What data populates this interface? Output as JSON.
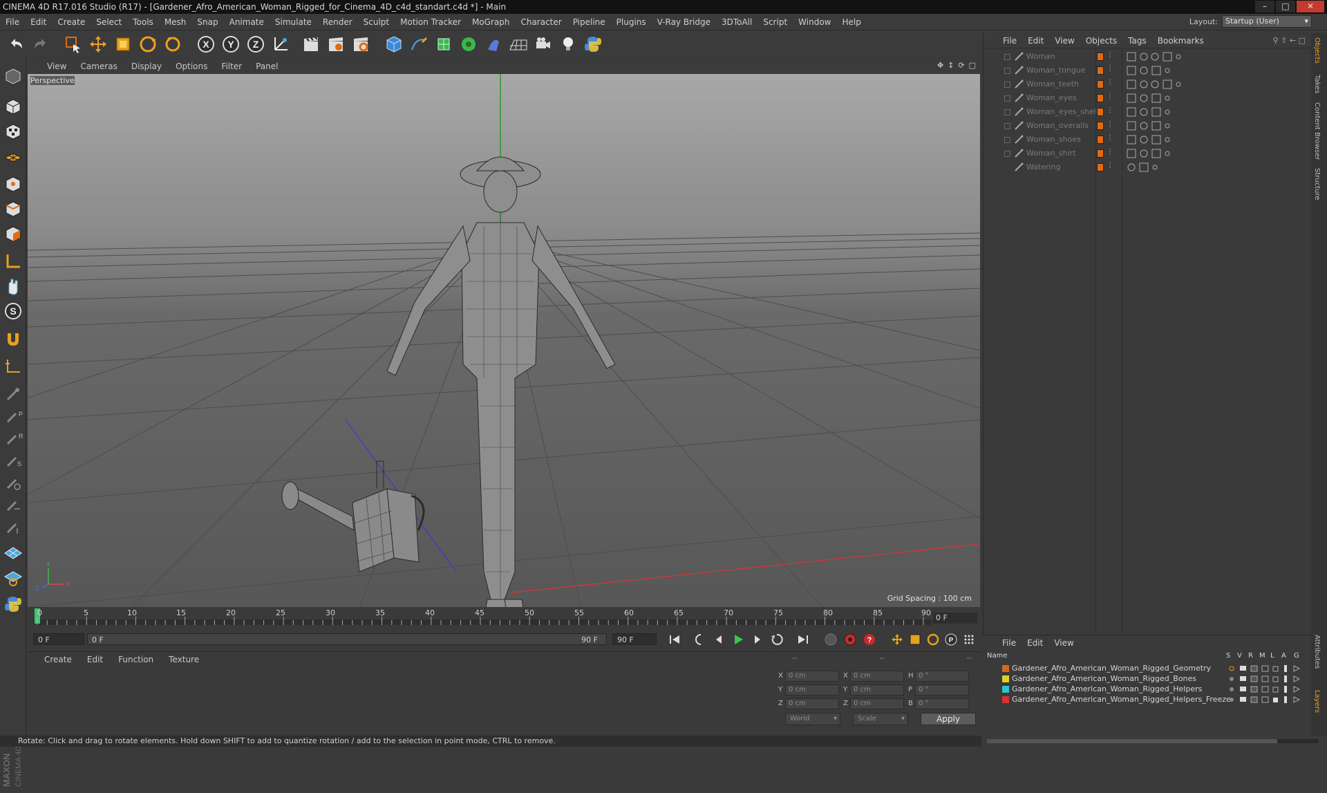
{
  "window": {
    "title": "CINEMA 4D R17.016 Studio (R17) - [Gardener_Afro_American_Woman_Rigged_for_Cinema_4D_c4d_standart.c4d *] - Main"
  },
  "menubar": {
    "items": [
      "File",
      "Edit",
      "Create",
      "Select",
      "Tools",
      "Mesh",
      "Snap",
      "Animate",
      "Simulate",
      "Render",
      "Sculpt",
      "Motion Tracker",
      "MoGraph",
      "Character",
      "Pipeline",
      "Plugins",
      "V-Ray Bridge",
      "3DToAll",
      "Script",
      "Window",
      "Help"
    ],
    "layout_label": "Layout:",
    "layout_value": "Startup (User)"
  },
  "viewport": {
    "menu": [
      "View",
      "Cameras",
      "Display",
      "Options",
      "Filter",
      "Panel"
    ],
    "label": "Perspective",
    "grid_spacing": "Grid Spacing : 100 cm"
  },
  "timeline": {
    "ticks": [
      "0",
      "5",
      "10",
      "15",
      "20",
      "25",
      "30",
      "35",
      "40",
      "45",
      "50",
      "55",
      "60",
      "65",
      "70",
      "75",
      "80",
      "85",
      "90"
    ],
    "current_frame": "0 F"
  },
  "transport": {
    "start_field": "0 F",
    "range_start": "0 F",
    "range_end": "90 F",
    "end_field": "90 F"
  },
  "material_manager": {
    "menu": [
      "Create",
      "Edit",
      "Function",
      "Texture"
    ]
  },
  "coordinates": {
    "header": [
      "--",
      "--",
      "--"
    ],
    "rows": [
      {
        "l1": "X",
        "v1": "0 cm",
        "l2": "X",
        "v2": "0 cm",
        "l3": "H",
        "v3": "0 °"
      },
      {
        "l1": "Y",
        "v1": "0 cm",
        "l2": "Y",
        "v2": "0 cm",
        "l3": "P",
        "v3": "0 °"
      },
      {
        "l1": "Z",
        "v1": "0 cm",
        "l2": "Z",
        "v2": "0 cm",
        "l3": "B",
        "v3": "0 °"
      }
    ],
    "mode_world": "World",
    "mode_scale": "Scale",
    "apply": "Apply"
  },
  "status": {
    "text": "Rotate: Click and drag to rotate elements. Hold down SHIFT to add to quantize rotation / add to the selection in point mode, CTRL to remove."
  },
  "object_manager": {
    "menu": [
      "File",
      "Edit",
      "View",
      "Objects",
      "Tags",
      "Bookmarks"
    ],
    "objects": [
      "Woman",
      "Woman_tongue",
      "Woman_teeth",
      "Woman_eyes",
      "Woman_eyes_shell",
      "Woman_overalls",
      "Woman_shoes",
      "Woman_shirt",
      "Watering"
    ]
  },
  "right_tabs": [
    "Objects",
    "Takes",
    "Content Browser",
    "Structure",
    "Attributes",
    "Layers"
  ],
  "layers": {
    "menu": [
      "File",
      "Edit",
      "View"
    ],
    "header_name": "Name",
    "header_cols": [
      "S",
      "V",
      "R",
      "M",
      "L",
      "A",
      "G"
    ],
    "items": [
      {
        "name": "Gardener_Afro_American_Woman_Rigged_Geometry",
        "color": "#d2691e"
      },
      {
        "name": "Gardener_Afro_American_Woman_Rigged_Bones",
        "color": "#e0d020"
      },
      {
        "name": "Gardener_Afro_American_Woman_Rigged_Helpers",
        "color": "#2fc2c8"
      },
      {
        "name": "Gardener_Afro_American_Woman_Rigged_Helpers_Freeze",
        "color": "#d83030"
      }
    ]
  },
  "brand": {
    "line1": "MAXON",
    "line2": "CINEMA 4D"
  }
}
